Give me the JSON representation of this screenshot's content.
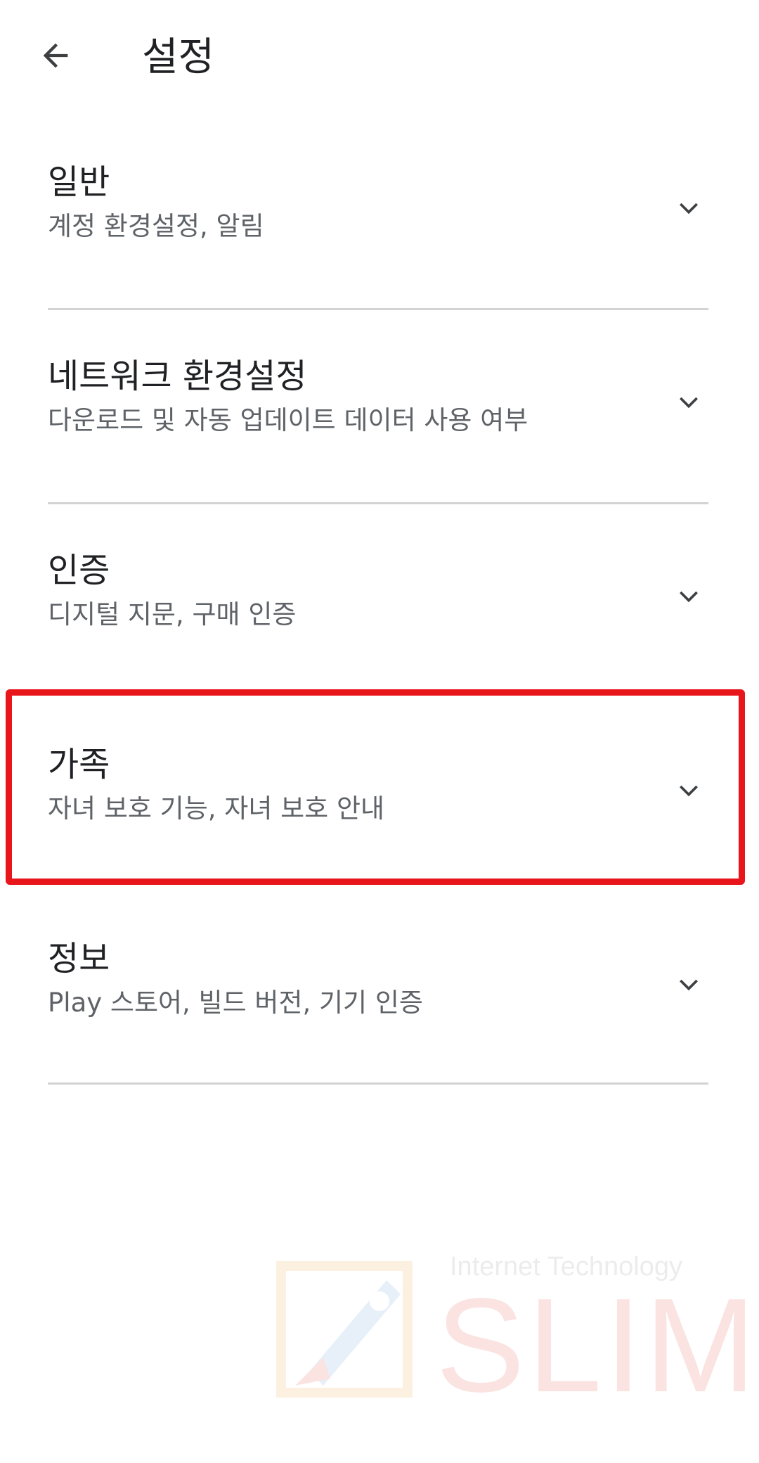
{
  "header": {
    "title": "설정",
    "back_icon": "arrow-back-icon"
  },
  "sections": [
    {
      "title": "일반",
      "subtitle": "계정 환경설정, 알림"
    },
    {
      "title": "네트워크 환경설정",
      "subtitle": "다운로드 및 자동 업데이트 데이터 사용 여부"
    },
    {
      "title": "인증",
      "subtitle": "디지털 지문, 구매 인증"
    },
    {
      "title": "가족",
      "subtitle": "자녀 보호 기능, 자녀 보호 안내"
    },
    {
      "title": "정보",
      "subtitle": "Play 스토어, 빌드 버전, 기기 인증"
    }
  ],
  "highlight": {
    "color": "#e8151b",
    "target": "가족"
  },
  "watermark": {
    "tagline": "Internet Technology",
    "brand": "SLIM"
  },
  "colors": {
    "text_primary": "#202124",
    "text_secondary": "#5f6368",
    "divider": "#d3d3d3"
  }
}
